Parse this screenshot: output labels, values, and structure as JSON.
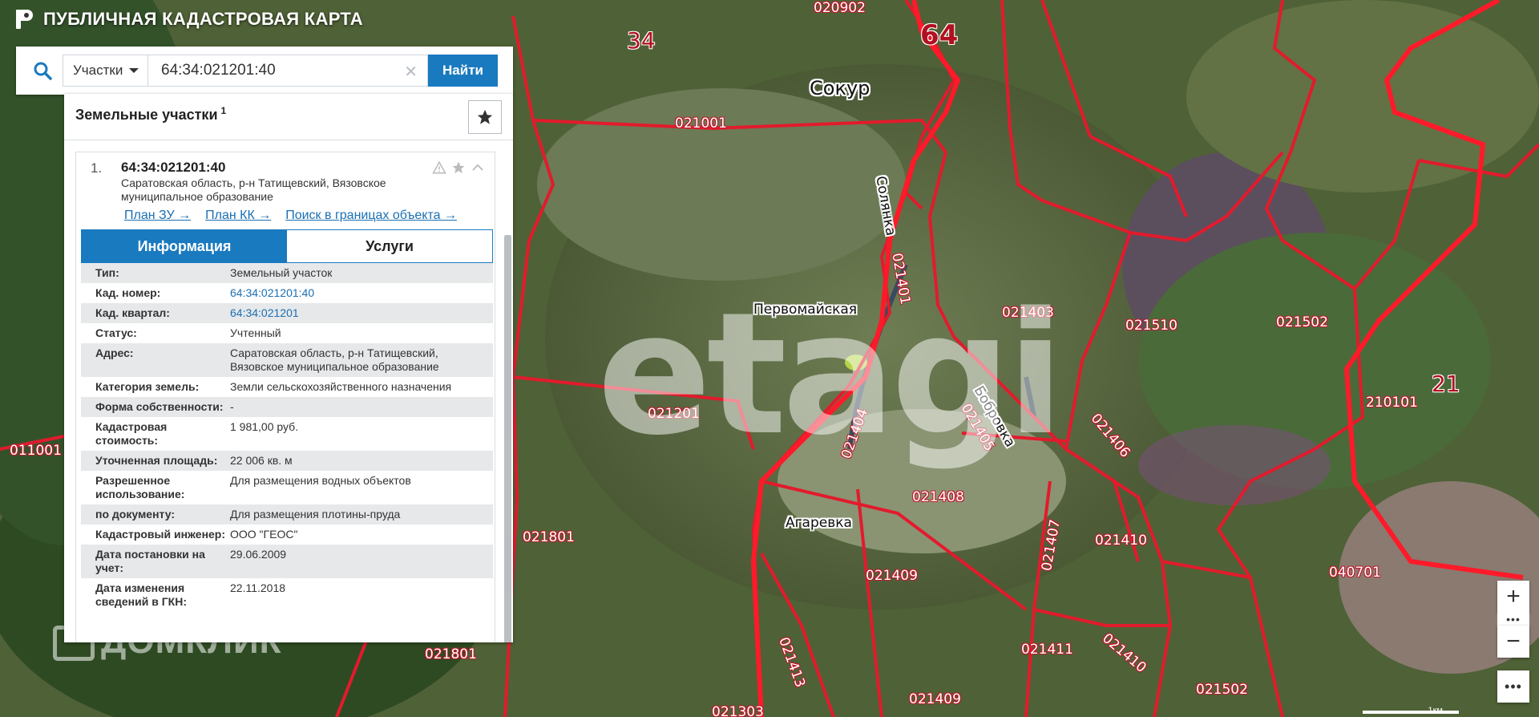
{
  "app": {
    "title": "ПУБЛИЧНАЯ КАДАСТРОВАЯ КАРТА"
  },
  "search": {
    "type_label": "Участки",
    "query": "64:34:021201:40",
    "find_label": "Найти"
  },
  "panel": {
    "title": "Земельные участки",
    "count": "1",
    "result": {
      "number": "1.",
      "id": "64:34:021201:40",
      "address": "Саратовская область, р-н Татищевский, Вязовское муниципальное образование",
      "links": [
        "План ЗУ →",
        "План КК →",
        "Поиск в границах объекта →"
      ],
      "tabs": [
        "Информация",
        "Услуги"
      ],
      "rows": [
        {
          "key": "Тип:",
          "value": "Земельный участок"
        },
        {
          "key": "Кад. номер:",
          "value": "64:34:021201:40"
        },
        {
          "key": "Кад. квартал:",
          "value": "64:34:021201"
        },
        {
          "key": "Статус:",
          "value": "Учтенный"
        },
        {
          "key": "Адрес:",
          "value": "Саратовская область, р-н Татищевский, Вязовское муниципальное образование"
        },
        {
          "key": "Категория земель:",
          "value": "Земли сельскохозяйственного назначения"
        },
        {
          "key": "Форма собственности:",
          "value": "-"
        },
        {
          "key": "Кадастровая стоимость:",
          "value": "1 981,00 руб."
        },
        {
          "key": "Уточненная площадь:",
          "value": "22 006 кв. м"
        },
        {
          "key": "Разрешенное использование:",
          "value": "Для размещения водных объектов"
        },
        {
          "key": "по документу:",
          "value": "Для размещения плотины-пруда"
        },
        {
          "key": "Кадастровый инженер:",
          "value": "ООО \"ГЕОС\""
        },
        {
          "key": "Дата постановки на учет:",
          "value": "29.06.2009"
        },
        {
          "key": "Дата изменения сведений в ГКН:",
          "value": "22.11.2018"
        }
      ]
    }
  },
  "map": {
    "region_labels": [
      "64",
      "34",
      "21"
    ],
    "parcel_labels": [
      "020902",
      "021001",
      "021401",
      "021403",
      "021510",
      "021502",
      "210101",
      "021201",
      "021404",
      "021405",
      "021406",
      "021408",
      "021407",
      "021410",
      "021409",
      "021801",
      "021801",
      "040701",
      "021411",
      "021410",
      "021413",
      "021409",
      "021502",
      "021303",
      "011001"
    ],
    "places": [
      "Сокур",
      "Первомайская",
      "Агаревка",
      "Бобровка",
      "Солянка"
    ],
    "watermark": "etagi",
    "brand": "ДОМКЛИК",
    "scale": "1км"
  },
  "controls": {
    "zoom_in": "+",
    "zoom_out": "−",
    "more": "•••"
  },
  "colors": {
    "accent": "#1a7abf",
    "boundary": "#e21b2c"
  }
}
